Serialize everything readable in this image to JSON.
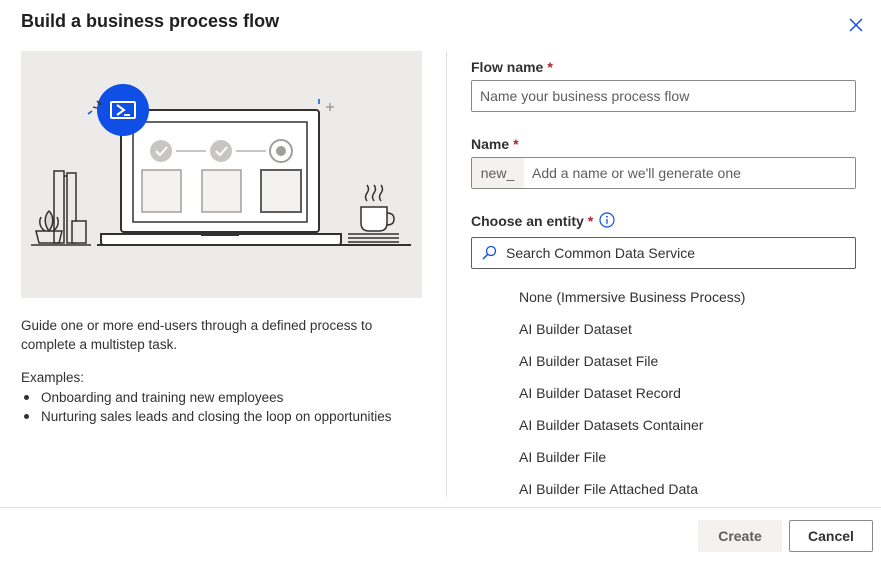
{
  "dialog": {
    "title": "Build a business process flow",
    "close_icon": "close-icon"
  },
  "left": {
    "illustration": "laptop-process-illustration",
    "description": "Guide one or more end-users through a defined process to complete a multistep task.",
    "examples_label": "Examples:",
    "examples": [
      "Onboarding and training new employees",
      "Nurturing sales leads and closing the loop on opportunities"
    ]
  },
  "form": {
    "flow_name": {
      "label": "Flow name",
      "required_mark": "*",
      "value": "",
      "placeholder": "Name your business process flow"
    },
    "name": {
      "label": "Name",
      "required_mark": "*",
      "prefix": "new_",
      "value": "",
      "placeholder": "Add a name or we'll generate one"
    },
    "entity": {
      "label": "Choose an entity",
      "required_mark": "*",
      "info_icon": "info-icon",
      "search_icon": "search-icon",
      "search_placeholder": "Search Common Data Service",
      "options": [
        "None (Immersive Business Process)",
        "AI Builder Dataset",
        "AI Builder Dataset File",
        "AI Builder Dataset Record",
        "AI Builder Datasets Container",
        "AI Builder File",
        "AI Builder File Attached Data"
      ]
    }
  },
  "footer": {
    "create_label": "Create",
    "cancel_label": "Cancel"
  },
  "colors": {
    "accent": "#0f4fe6",
    "required": "#a4262c",
    "illustration_bg": "#edebe9"
  }
}
